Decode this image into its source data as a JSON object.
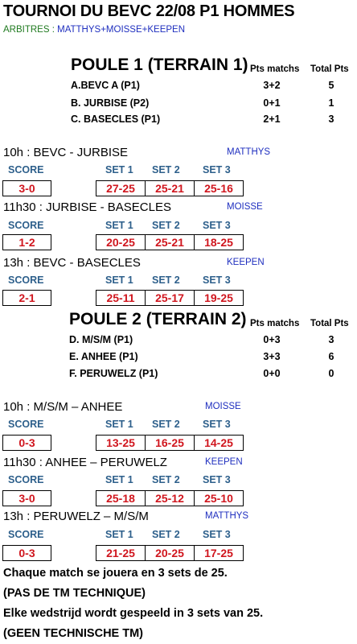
{
  "title": "TOURNOI DU BEVC 22/08 P1 HOMMES",
  "arbitres": {
    "label": "ARBITRES :",
    "names": "MATTHYS+MOISSE+KEEPEN"
  },
  "poule1": {
    "title": "POULE 1 (TERRAIN 1)",
    "col_pts_matchs": "Pts matchs",
    "col_total": "Total Pts",
    "teams": [
      {
        "name": "A.BEVC A (P1)",
        "pts_matchs": "3+2",
        "total": "5"
      },
      {
        "name": "B. JURBISE (P2)",
        "pts_matchs": "0+1",
        "total": "1"
      },
      {
        "name": "C. BASECLES (P1)",
        "pts_matchs": "2+1",
        "total": "3"
      }
    ]
  },
  "poule2": {
    "title": "POULE 2 (TERRAIN 2)",
    "col_pts_matchs": "Pts matchs",
    "col_total": "Total Pts",
    "teams": [
      {
        "name": "D. M/S/M (P1)",
        "pts_matchs": "0+3",
        "total": "3"
      },
      {
        "name": "E. ANHEE (P1)",
        "pts_matchs": "3+3",
        "total": "6"
      },
      {
        "name": "F. PERUWELZ (P1)",
        "pts_matchs": "0+0",
        "total": "0"
      }
    ]
  },
  "headers": {
    "score": "SCORE",
    "set1": "SET 1",
    "set2": "SET 2",
    "set3": "SET 3"
  },
  "matches": [
    {
      "title": "10h : BEVC - JURBISE",
      "referee": "MATTHYS",
      "score": "3-0",
      "sets": [
        "27-25",
        "25-21",
        "25-16"
      ]
    },
    {
      "title": "11h30 : JURBISE - BASECLES",
      "referee": "MOISSE",
      "score": "1-2",
      "sets": [
        "20-25",
        "25-21",
        "18-25"
      ]
    },
    {
      "title": "13h : BEVC - BASECLES",
      "referee": "KEEPEN",
      "score": "2-1",
      "sets": [
        "25-11",
        "25-17",
        "19-25"
      ]
    },
    {
      "title": "10h : M/S/M – ANHEE",
      "referee": "MOISSE",
      "score": "0-3",
      "sets": [
        "13-25",
        "16-25",
        "14-25"
      ]
    },
    {
      "title": "11h30 : ANHEE – PERUWELZ",
      "referee": "KEEPEN",
      "score": "3-0",
      "sets": [
        "25-18",
        "25-12",
        "25-10"
      ]
    },
    {
      "title": "13h : PERUWELZ – M/S/M",
      "referee": "MATTHYS",
      "score": "0-3",
      "sets": [
        "21-25",
        "20-25",
        "17-25"
      ]
    }
  ],
  "notes": [
    "Chaque match se jouera en 3 sets de 25.",
    "(PAS DE TM TECHNIQUE)",
    "Elke wedstrijd wordt gespeeld in 3 sets van 25.",
    "(GEEN TECHNISCHE TM)"
  ]
}
